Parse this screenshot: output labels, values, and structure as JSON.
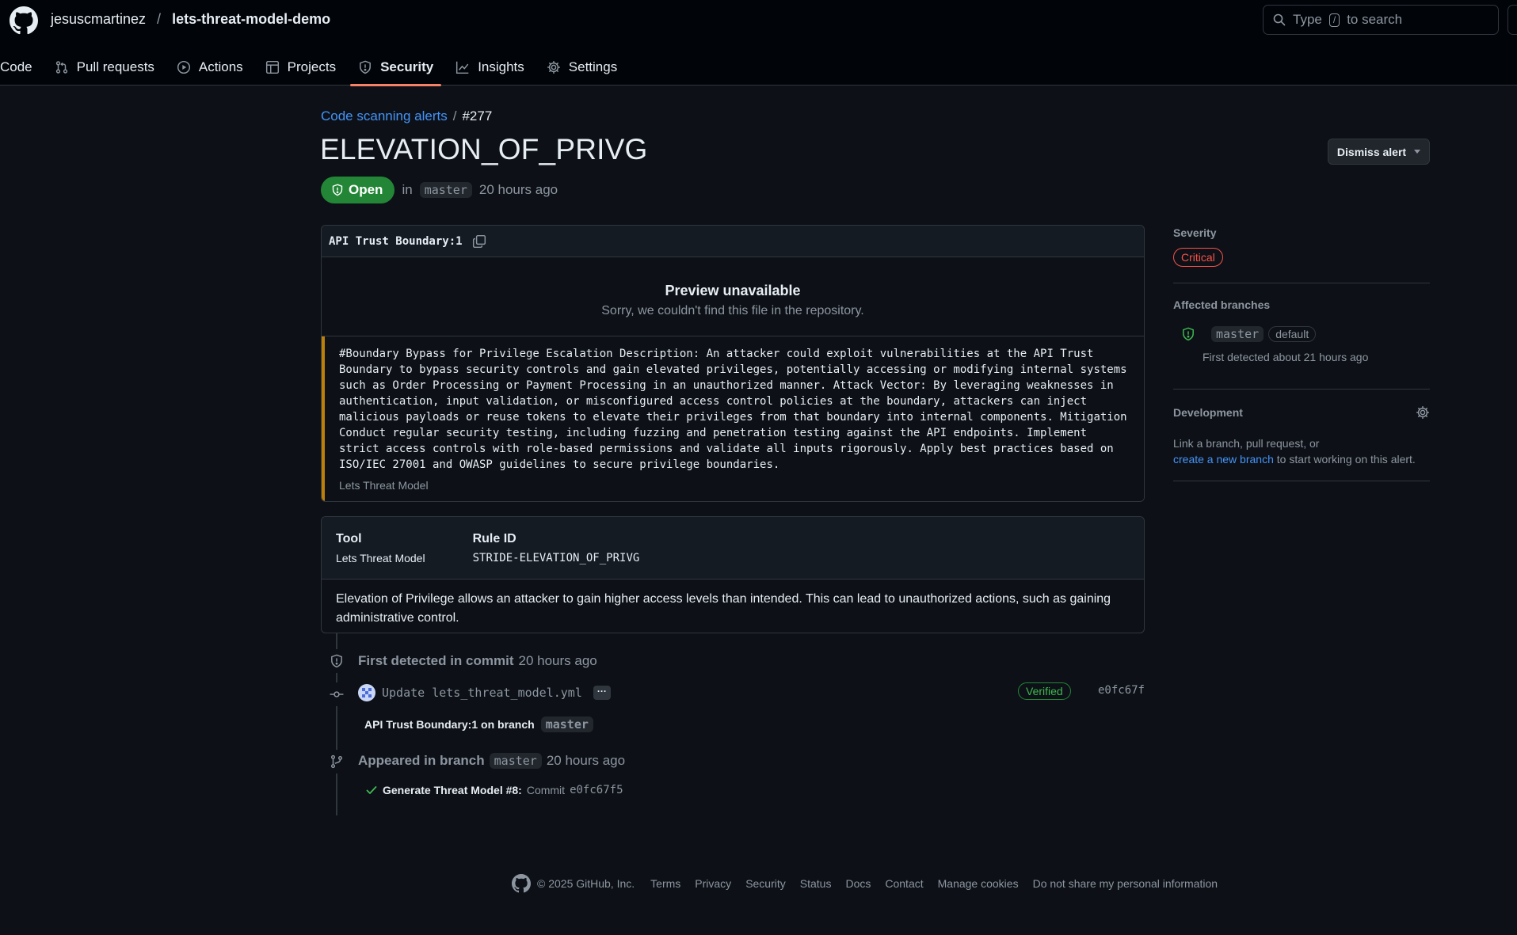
{
  "header": {
    "owner": "jesuscmartinez",
    "separator": "/",
    "repo": "lets-threat-model-demo",
    "search": {
      "prefix": "Type",
      "key": "/",
      "suffix": "to search"
    }
  },
  "nav": {
    "tabs": [
      {
        "label": "Code"
      },
      {
        "label": "Pull requests"
      },
      {
        "label": "Actions"
      },
      {
        "label": "Projects"
      },
      {
        "label": "Security",
        "active": true
      },
      {
        "label": "Insights"
      },
      {
        "label": "Settings"
      }
    ]
  },
  "alert": {
    "breadcrumb_link": "Code scanning alerts",
    "breadcrumb_sep": "/",
    "number": "#277",
    "title": "ELEVATION_OF_PRIVG",
    "dismiss_label": "Dismiss alert",
    "state": "Open",
    "in_text": "in",
    "branch": "master",
    "time": "20 hours ago"
  },
  "location": {
    "path": "API Trust Boundary:1",
    "preview_title": "Preview unavailable",
    "preview_sub": "Sorry, we couldn't find this file in the repository.",
    "message": "#Boundary Bypass for Privilege Escalation Description: An attacker could exploit vulnerabilities at the API Trust Boundary to bypass security controls and gain elevated privileges, potentially accessing or modifying internal systems such as Order Processing or Payment Processing in an unauthorized manner. Attack Vector: By leveraging weaknesses in authentication, input validation, or misconfigured access control policies at the boundary, attackers can inject malicious payloads or reuse tokens to elevate their privileges from that boundary into internal components. Mitigation Conduct regular security testing, including fuzzing and penetration testing against the API endpoints. Implement strict access controls with role-based permissions and validate all inputs rigorously. Apply best practices based on ISO/IEC 27001 and OWASP guidelines to secure privilege boundaries.",
    "tool": "Lets Threat Model"
  },
  "rule": {
    "tool_header": "Tool",
    "tool_value": "Lets Threat Model",
    "rule_header": "Rule ID",
    "rule_value": "STRIDE-ELEVATION_OF_PRIVG",
    "description": "Elevation of Privilege allows an attacker to gain higher access levels than intended. This can lead to unauthorized actions, such as gaining administrative control."
  },
  "timeline": {
    "first_detected_label": "First detected in commit",
    "first_detected_time": "20 hours ago",
    "commit_message": "Update lets_threat_model.yml",
    "ellipsis": "···",
    "verified": "Verified",
    "sha": "e0fc67f",
    "location_text": "API Trust Boundary:1 on branch",
    "location_branch": "master",
    "appeared_label": "Appeared in branch",
    "appeared_branch": "master",
    "appeared_time": "20 hours ago",
    "check_name": "Generate Threat Model #8:",
    "check_commit_label": "Commit",
    "check_sha": "e0fc67f5"
  },
  "sidebar": {
    "severity_label": "Severity",
    "severity_value": "Critical",
    "branches_label": "Affected branches",
    "branch_name": "master",
    "branch_default": "default",
    "branch_detected": "First detected about 21 hours ago",
    "development_label": "Development",
    "development_text_1": "Link a branch, pull request, or",
    "development_link": "create a new branch",
    "development_text_2": "to start working on this alert."
  },
  "footer": {
    "copyright": "© 2025 GitHub, Inc.",
    "links": [
      "Terms",
      "Privacy",
      "Security",
      "Status",
      "Docs",
      "Contact",
      "Manage cookies",
      "Do not share my personal information"
    ]
  },
  "colors": {
    "background": "#0d1117",
    "header_bg": "#010409",
    "accent_link": "#4493f8",
    "open_green": "#238636",
    "critical_red": "#f85149",
    "tab_underline": "#f78166"
  }
}
